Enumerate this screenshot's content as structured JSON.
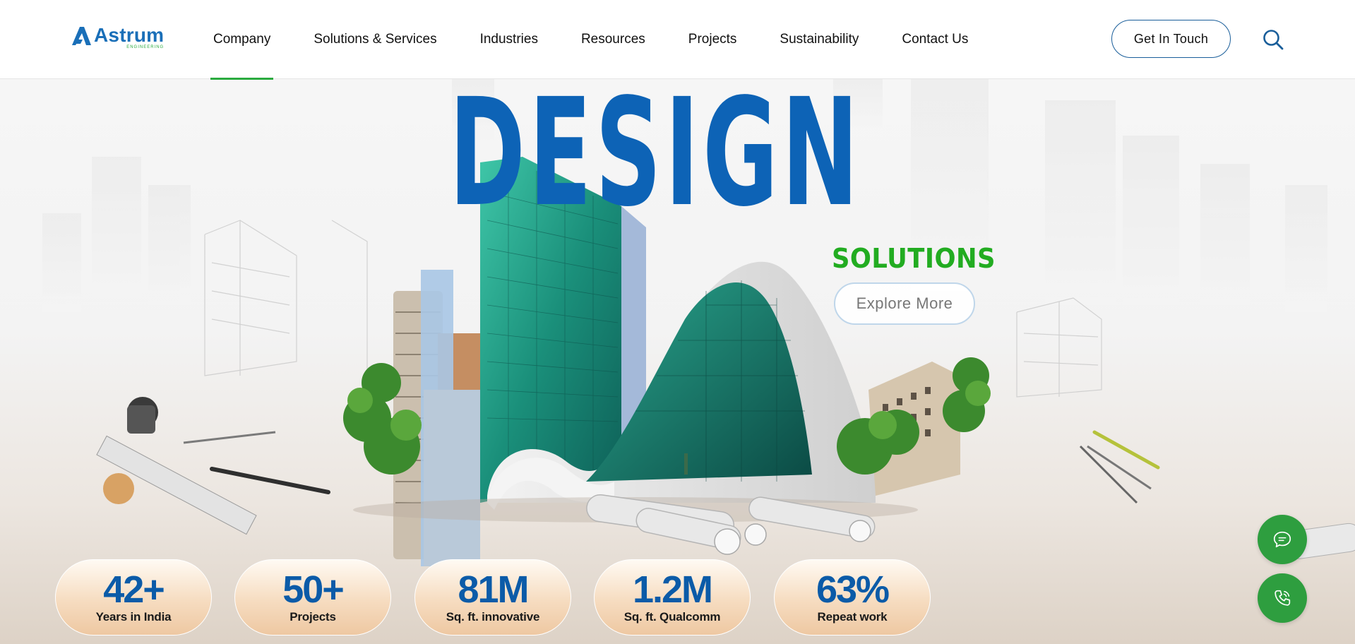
{
  "header": {
    "logo": {
      "name": "Astrum",
      "sub": "ENGINEERING"
    },
    "nav": [
      {
        "label": "Company",
        "active": true
      },
      {
        "label": "Solutions & Services"
      },
      {
        "label": "Industries"
      },
      {
        "label": "Resources"
      },
      {
        "label": "Projects"
      },
      {
        "label": "Sustainability"
      },
      {
        "label": "Contact Us"
      }
    ],
    "cta_label": "Get In Touch",
    "search_icon": "search-icon"
  },
  "hero": {
    "title": "DESIGN",
    "subtitle": "SOLUTIONS",
    "button_label": "Explore More",
    "stats": [
      {
        "value": "42+",
        "label": "Years in India"
      },
      {
        "value": "50+",
        "label": "Projects"
      },
      {
        "value": "81M",
        "label": "Sq. ft. innovative"
      },
      {
        "value": "1.2M",
        "label": "Sq. ft. Qualcomm"
      },
      {
        "value": "63%",
        "label": "Repeat work"
      }
    ]
  },
  "floating": {
    "chat_icon": "chat-icon",
    "phone_icon": "phone-icon"
  },
  "colors": {
    "brand_blue": "#0d63b6",
    "brand_green": "#2bab3f",
    "float_green": "#2e9e3f"
  }
}
